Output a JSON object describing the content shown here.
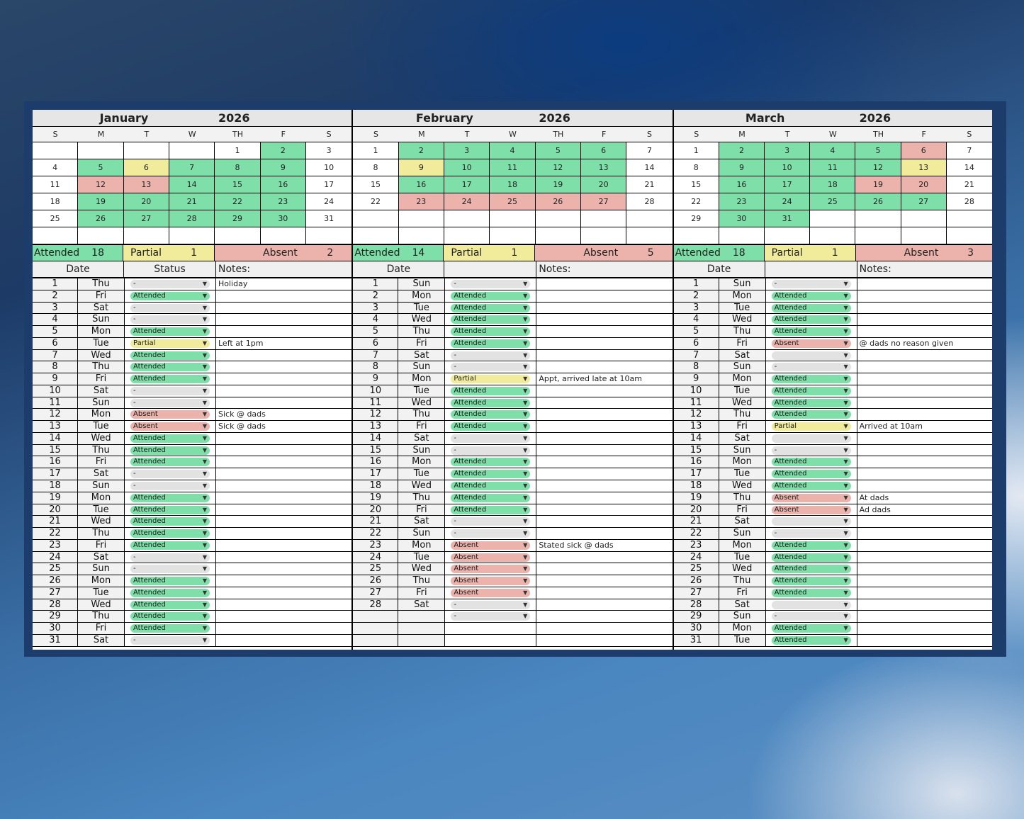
{
  "months": [
    {
      "name": "January",
      "year": "2026",
      "dow": [
        "S",
        "M",
        "T",
        "W",
        "TH",
        "F",
        "S"
      ],
      "calendar": [
        [
          [
            "",
            ""
          ],
          [
            "",
            ""
          ],
          [
            "",
            ""
          ],
          [
            "",
            ""
          ],
          [
            "1",
            ""
          ],
          [
            "2",
            "green"
          ],
          [
            "3",
            ""
          ]
        ],
        [
          [
            "4",
            ""
          ],
          [
            "5",
            "green"
          ],
          [
            "6",
            "yellow"
          ],
          [
            "7",
            "green"
          ],
          [
            "8",
            "green"
          ],
          [
            "9",
            "green"
          ],
          [
            "10",
            ""
          ]
        ],
        [
          [
            "11",
            ""
          ],
          [
            "12",
            "red"
          ],
          [
            "13",
            "red"
          ],
          [
            "14",
            "green"
          ],
          [
            "15",
            "green"
          ],
          [
            "16",
            "green"
          ],
          [
            "17",
            ""
          ]
        ],
        [
          [
            "18",
            ""
          ],
          [
            "19",
            "green"
          ],
          [
            "20",
            "green"
          ],
          [
            "21",
            "green"
          ],
          [
            "22",
            "green"
          ],
          [
            "23",
            "green"
          ],
          [
            "24",
            ""
          ]
        ],
        [
          [
            "25",
            ""
          ],
          [
            "26",
            "green"
          ],
          [
            "27",
            "green"
          ],
          [
            "28",
            "green"
          ],
          [
            "29",
            "green"
          ],
          [
            "30",
            "green"
          ],
          [
            "31",
            ""
          ]
        ],
        [
          [
            "",
            ""
          ],
          [
            "",
            ""
          ],
          [
            "",
            ""
          ],
          [
            "",
            ""
          ],
          [
            "",
            ""
          ],
          [
            "",
            ""
          ],
          [
            "",
            ""
          ]
        ]
      ],
      "summary": {
        "attended_label": "Attended",
        "attended": "18",
        "partial_label": "Partial",
        "partial": "1",
        "absent_label": "Absent",
        "absent": "2"
      },
      "headers": {
        "date": "Date",
        "status": "Status",
        "notes": "Notes:"
      },
      "rows": [
        [
          "1",
          "Thu",
          "-",
          "Holiday"
        ],
        [
          "2",
          "Fri",
          "Attended",
          ""
        ],
        [
          "3",
          "Sat",
          "-",
          ""
        ],
        [
          "4",
          "Sun",
          "-",
          ""
        ],
        [
          "5",
          "Mon",
          "Attended",
          ""
        ],
        [
          "6",
          "Tue",
          "Partial",
          "Left at 1pm"
        ],
        [
          "7",
          "Wed",
          "Attended",
          ""
        ],
        [
          "8",
          "Thu",
          "Attended",
          ""
        ],
        [
          "9",
          "Fri",
          "Attended",
          ""
        ],
        [
          "10",
          "Sat",
          "-",
          ""
        ],
        [
          "11",
          "Sun",
          "-",
          ""
        ],
        [
          "12",
          "Mon",
          "Absent",
          "Sick @ dads"
        ],
        [
          "13",
          "Tue",
          "Absent",
          "Sick @ dads"
        ],
        [
          "14",
          "Wed",
          "Attended",
          ""
        ],
        [
          "15",
          "Thu",
          "Attended",
          ""
        ],
        [
          "16",
          "Fri",
          "Attended",
          ""
        ],
        [
          "17",
          "Sat",
          "-",
          ""
        ],
        [
          "18",
          "Sun",
          "-",
          ""
        ],
        [
          "19",
          "Mon",
          "Attended",
          ""
        ],
        [
          "20",
          "Tue",
          "Attended",
          ""
        ],
        [
          "21",
          "Wed",
          "Attended",
          ""
        ],
        [
          "22",
          "Thu",
          "Attended",
          ""
        ],
        [
          "23",
          "Fri",
          "Attended",
          ""
        ],
        [
          "24",
          "Sat",
          "-",
          ""
        ],
        [
          "25",
          "Sun",
          "-",
          ""
        ],
        [
          "26",
          "Mon",
          "Attended",
          ""
        ],
        [
          "27",
          "Tue",
          "Attended",
          ""
        ],
        [
          "28",
          "Wed",
          "Attended",
          ""
        ],
        [
          "29",
          "Thu",
          "Attended",
          ""
        ],
        [
          "30",
          "Fri",
          "Attended",
          ""
        ],
        [
          "31",
          "Sat",
          "-",
          ""
        ]
      ]
    },
    {
      "name": "February",
      "year": "2026",
      "dow": [
        "S",
        "M",
        "T",
        "W",
        "TH",
        "F",
        "S"
      ],
      "calendar": [
        [
          [
            "1",
            ""
          ],
          [
            "2",
            "green"
          ],
          [
            "3",
            "green"
          ],
          [
            "4",
            "green"
          ],
          [
            "5",
            "green"
          ],
          [
            "6",
            "green"
          ],
          [
            "7",
            ""
          ]
        ],
        [
          [
            "8",
            ""
          ],
          [
            "9",
            "yellow"
          ],
          [
            "10",
            "green"
          ],
          [
            "11",
            "green"
          ],
          [
            "12",
            "green"
          ],
          [
            "13",
            "green"
          ],
          [
            "14",
            ""
          ]
        ],
        [
          [
            "15",
            ""
          ],
          [
            "16",
            "green"
          ],
          [
            "17",
            "green"
          ],
          [
            "18",
            "green"
          ],
          [
            "19",
            "green"
          ],
          [
            "20",
            "green"
          ],
          [
            "21",
            ""
          ]
        ],
        [
          [
            "22",
            ""
          ],
          [
            "23",
            "red"
          ],
          [
            "24",
            "red"
          ],
          [
            "25",
            "red"
          ],
          [
            "26",
            "red"
          ],
          [
            "27",
            "red"
          ],
          [
            "28",
            ""
          ]
        ],
        [
          [
            "",
            ""
          ],
          [
            "",
            ""
          ],
          [
            "",
            ""
          ],
          [
            "",
            ""
          ],
          [
            "",
            ""
          ],
          [
            "",
            ""
          ],
          [
            "",
            ""
          ]
        ],
        [
          [
            "",
            ""
          ],
          [
            "",
            ""
          ],
          [
            "",
            ""
          ],
          [
            "",
            ""
          ],
          [
            "",
            ""
          ],
          [
            "",
            ""
          ],
          [
            "",
            ""
          ]
        ]
      ],
      "summary": {
        "attended_label": "Attended",
        "attended": "14",
        "partial_label": "Partial",
        "partial": "1",
        "absent_label": "Absent",
        "absent": "5"
      },
      "headers": {
        "date": "Date",
        "status": "",
        "notes": "Notes:"
      },
      "rows": [
        [
          "1",
          "Sun",
          "-",
          ""
        ],
        [
          "2",
          "Mon",
          "Attended",
          ""
        ],
        [
          "3",
          "Tue",
          "Attended",
          ""
        ],
        [
          "4",
          "Wed",
          "Attended",
          ""
        ],
        [
          "5",
          "Thu",
          "Attended",
          ""
        ],
        [
          "6",
          "Fri",
          "Attended",
          ""
        ],
        [
          "7",
          "Sat",
          "-",
          ""
        ],
        [
          "8",
          "Sun",
          "-",
          ""
        ],
        [
          "9",
          "Mon",
          "Partial",
          "Appt, arrived late at 10am"
        ],
        [
          "10",
          "Tue",
          "Attended",
          ""
        ],
        [
          "11",
          "Wed",
          "Attended",
          ""
        ],
        [
          "12",
          "Thu",
          "Attended",
          ""
        ],
        [
          "13",
          "Fri",
          "Attended",
          ""
        ],
        [
          "14",
          "Sat",
          "-",
          ""
        ],
        [
          "15",
          "Sun",
          "-",
          ""
        ],
        [
          "16",
          "Mon",
          "Attended",
          ""
        ],
        [
          "17",
          "Tue",
          "Attended",
          ""
        ],
        [
          "18",
          "Wed",
          "Attended",
          ""
        ],
        [
          "19",
          "Thu",
          "Attended",
          ""
        ],
        [
          "20",
          "Fri",
          "Attended",
          ""
        ],
        [
          "21",
          "Sat",
          "-",
          ""
        ],
        [
          "22",
          "Sun",
          "-",
          ""
        ],
        [
          "23",
          "Mon",
          "Absent",
          "Stated sick @ dads"
        ],
        [
          "24",
          "Tue",
          "Absent",
          ""
        ],
        [
          "25",
          "Wed",
          "Absent",
          ""
        ],
        [
          "26",
          "Thu",
          "Absent",
          ""
        ],
        [
          "27",
          "Fri",
          "Absent",
          ""
        ],
        [
          "28",
          "Sat",
          "-",
          ""
        ],
        [
          "",
          "",
          "-",
          ""
        ],
        [
          "",
          "",
          "",
          ""
        ],
        [
          "",
          "",
          "",
          ""
        ]
      ]
    },
    {
      "name": "March",
      "year": "2026",
      "dow": [
        "S",
        "M",
        "T",
        "W",
        "TH",
        "F",
        "S"
      ],
      "calendar": [
        [
          [
            "1",
            ""
          ],
          [
            "2",
            "green"
          ],
          [
            "3",
            "green"
          ],
          [
            "4",
            "green"
          ],
          [
            "5",
            "green"
          ],
          [
            "6",
            "red"
          ],
          [
            "7",
            ""
          ]
        ],
        [
          [
            "8",
            ""
          ],
          [
            "9",
            "green"
          ],
          [
            "10",
            "green"
          ],
          [
            "11",
            "green"
          ],
          [
            "12",
            "green"
          ],
          [
            "13",
            "yellow"
          ],
          [
            "14",
            ""
          ]
        ],
        [
          [
            "15",
            ""
          ],
          [
            "16",
            "green"
          ],
          [
            "17",
            "green"
          ],
          [
            "18",
            "green"
          ],
          [
            "19",
            "red"
          ],
          [
            "20",
            "red"
          ],
          [
            "21",
            ""
          ]
        ],
        [
          [
            "22",
            ""
          ],
          [
            "23",
            "green"
          ],
          [
            "24",
            "green"
          ],
          [
            "25",
            "green"
          ],
          [
            "26",
            "green"
          ],
          [
            "27",
            "green"
          ],
          [
            "28",
            ""
          ]
        ],
        [
          [
            "29",
            ""
          ],
          [
            "30",
            "green"
          ],
          [
            "31",
            "green"
          ],
          [
            "",
            ""
          ],
          [
            "",
            ""
          ],
          [
            "",
            ""
          ],
          [
            "",
            ""
          ]
        ],
        [
          [
            "",
            ""
          ],
          [
            "",
            ""
          ],
          [
            "",
            ""
          ],
          [
            "",
            ""
          ],
          [
            "",
            ""
          ],
          [
            "",
            ""
          ],
          [
            "",
            ""
          ]
        ]
      ],
      "summary": {
        "attended_label": "Attended",
        "attended": "18",
        "partial_label": "Partial",
        "partial": "1",
        "absent_label": "Absent",
        "absent": "3"
      },
      "headers": {
        "date": "Date",
        "status": "",
        "notes": "Notes:"
      },
      "rows": [
        [
          "1",
          "Sun",
          "-",
          ""
        ],
        [
          "2",
          "Mon",
          "Attended",
          ""
        ],
        [
          "3",
          "Tue",
          "Attended",
          ""
        ],
        [
          "4",
          "Wed",
          "Attended",
          ""
        ],
        [
          "5",
          "Thu",
          "Attended",
          ""
        ],
        [
          "6",
          "Fri",
          "Absent",
          "@ dads no reason given"
        ],
        [
          "7",
          "Sat",
          "",
          ""
        ],
        [
          "8",
          "Sun",
          "-",
          ""
        ],
        [
          "9",
          "Mon",
          "Attended",
          ""
        ],
        [
          "10",
          "Tue",
          "Attended",
          ""
        ],
        [
          "11",
          "Wed",
          "Attended",
          ""
        ],
        [
          "12",
          "Thu",
          "Attended",
          ""
        ],
        [
          "13",
          "Fri",
          "Partial",
          "Arrived at 10am"
        ],
        [
          "14",
          "Sat",
          "",
          ""
        ],
        [
          "15",
          "Sun",
          "-",
          ""
        ],
        [
          "16",
          "Mon",
          "Attended",
          ""
        ],
        [
          "17",
          "Tue",
          "Attended",
          ""
        ],
        [
          "18",
          "Wed",
          "Attended",
          ""
        ],
        [
          "19",
          "Thu",
          "Absent",
          "At dads"
        ],
        [
          "20",
          "Fri",
          "Absent",
          "Ad dads"
        ],
        [
          "21",
          "Sat",
          "",
          ""
        ],
        [
          "22",
          "Sun",
          "-",
          ""
        ],
        [
          "23",
          "Mon",
          "Attended",
          ""
        ],
        [
          "24",
          "Tue",
          "Attended",
          ""
        ],
        [
          "25",
          "Wed",
          "Attended",
          ""
        ],
        [
          "26",
          "Thu",
          "Attended",
          ""
        ],
        [
          "27",
          "Fri",
          "Attended",
          ""
        ],
        [
          "28",
          "Sat",
          "",
          ""
        ],
        [
          "29",
          "Sun",
          "-",
          ""
        ],
        [
          "30",
          "Mon",
          "Attended",
          ""
        ],
        [
          "31",
          "Tue",
          "Attended",
          ""
        ]
      ]
    }
  ],
  "status_colors": {
    "Attended": "#7ee0a8",
    "Partial": "#f1ec9c",
    "Absent": "#ebb3ac",
    "none": "#e2e2e2"
  },
  "icons": {
    "dropdown": "dropdown-arrow-icon"
  }
}
